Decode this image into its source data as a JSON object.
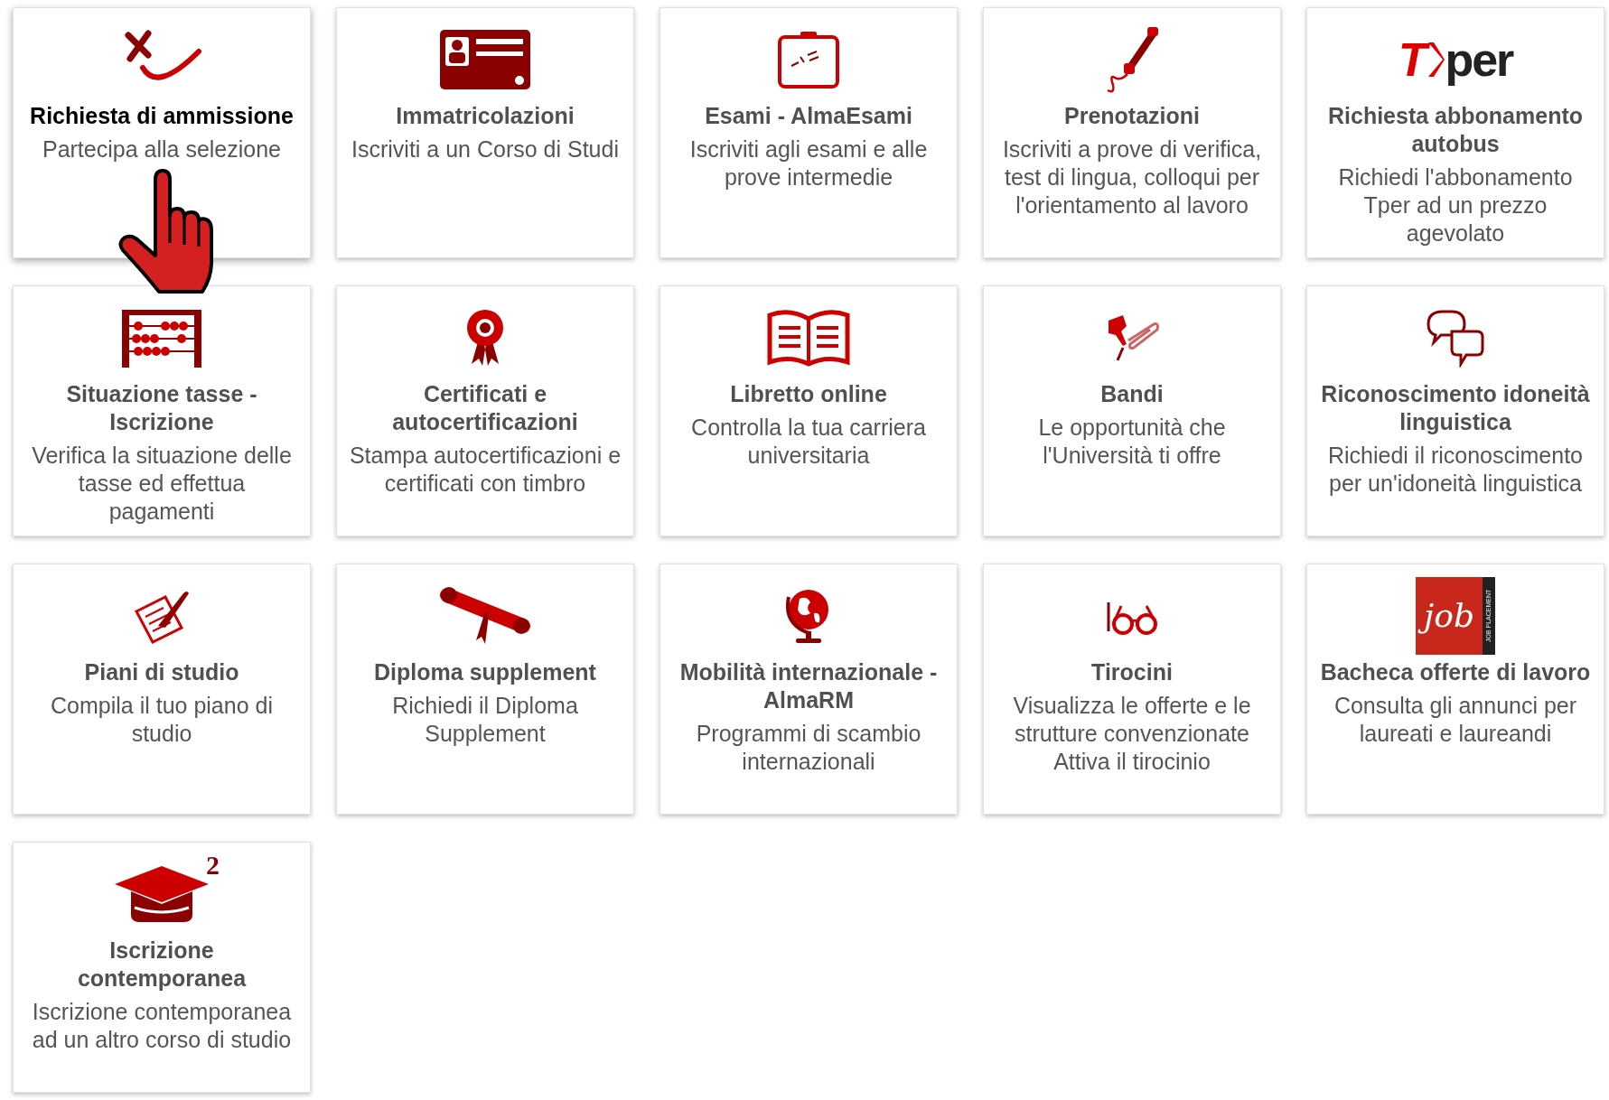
{
  "tiles": [
    {
      "title": "Richiesta di ammissione",
      "description": "Partecipa alla selezione",
      "selected": true
    },
    {
      "title": "Immatricolazioni",
      "description": "Iscriviti a un Corso di Studi",
      "selected": false
    },
    {
      "title": "Esami - AlmaEsami",
      "description": "Iscriviti agli esami e alle prove intermedie",
      "selected": false
    },
    {
      "title": "Prenotazioni",
      "description": "Iscriviti a prove di verifica, test di lingua, colloqui per l'orientamento al lavoro",
      "selected": false
    },
    {
      "title": "Richiesta abbonamento autobus",
      "description": "Richiedi l'abbonamento Tper ad un prezzo agevolato",
      "selected": false,
      "logo": [
        "T",
        "per"
      ]
    },
    {
      "title": "Situazione tasse - Iscrizione",
      "description": "Verifica la situazione delle tasse ed effettua pagamenti",
      "selected": false
    },
    {
      "title": "Certificati e autocertificazioni",
      "description": "Stampa autocertificazioni e certificati con timbro",
      "selected": false
    },
    {
      "title": "Libretto online",
      "description": "Controlla la tua carriera universitaria",
      "selected": false
    },
    {
      "title": "Bandi",
      "description": "Le opportunità che l'Università ti offre",
      "selected": false
    },
    {
      "title": "Riconoscimento idoneità linguistica",
      "description": "Richiedi il riconoscimento per un'idoneità linguistica",
      "selected": false
    },
    {
      "title": "Piani di studio",
      "description": "Compila il tuo piano di studio",
      "selected": false
    },
    {
      "title": "Diploma supplement",
      "description": "Richiedi il Diploma Supplement",
      "selected": false
    },
    {
      "title": "Mobilità internazionale - AlmaRM",
      "description": "Programmi di scambio internazionali",
      "selected": false
    },
    {
      "title": "Tirocini",
      "description": "Visualizza le offerte e le strutture convenzionate Attiva il tirocinio",
      "selected": false
    },
    {
      "title": "Bacheca offerte di lavoro",
      "description": "Consulta gli annunci per laureati e laureandi",
      "selected": false,
      "logo": [
        "job",
        "JOB PLACEMENT"
      ]
    },
    {
      "title": "Iscrizione contemporanea",
      "description": "Iscrizione contemporanea ad un altro corso di studio",
      "selected": false,
      "badge": "2"
    }
  ]
}
